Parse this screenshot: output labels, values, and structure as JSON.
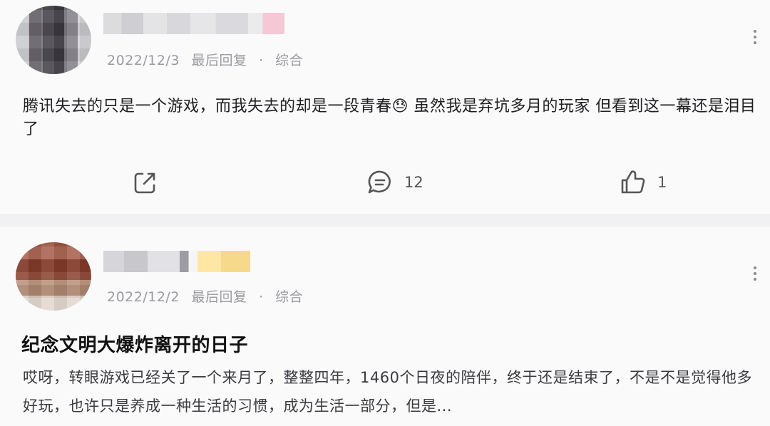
{
  "posts": [
    {
      "date": "2022/12/3",
      "reply_label": "最后回复",
      "separator": "·",
      "category": "综合",
      "body": "腾讯失去的只是一个游戏，而我失去的却是一段青春😓 虽然我是弃坑多月的玩家 但看到这一幕还是泪目了",
      "comment_count": "12",
      "like_count": "1"
    },
    {
      "date": "2022/12/2",
      "reply_label": "最后回复",
      "separator": "·",
      "category": "综合",
      "title": "纪念文明大爆炸离开的日子",
      "body": "哎呀，转眼游戏已经关了一个来月了，整整四年，1460个日夜的陪伴，终于还是结束了，不是不是觉得他多好玩，也许只是养成一种生活的习惯，成为生活一部分，但是..."
    }
  ],
  "icons": {
    "share": "share-icon",
    "comment": "comment-icon",
    "like": "thumbs-up-icon",
    "more": "more-vertical-icon"
  }
}
